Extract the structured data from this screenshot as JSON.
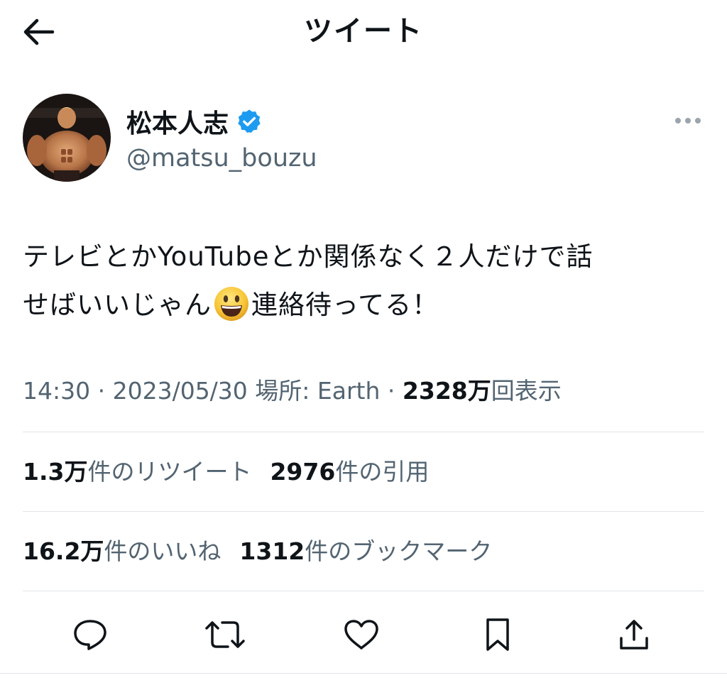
{
  "header": {
    "title": "ツイート",
    "back_icon": "arrow-left-icon"
  },
  "author": {
    "name": "松本人志",
    "handle": "@matsu_bouzu",
    "verified": true,
    "verified_color": "#1d9bf0"
  },
  "tweet": {
    "line1": "テレビとかYouTubeとか関係なく２人だけで話",
    "line2_before_emoji": "せばいいじゃん",
    "emoji": "smiley-emoji",
    "line2_after_emoji": "連絡待ってる！"
  },
  "meta": {
    "time": "14:30",
    "separator1": " · ",
    "date": "2023/05/30",
    "location_label": " 場所: ",
    "location": "Earth",
    "separator2": " · ",
    "views_count": "2328万",
    "views_label": "回表示"
  },
  "stats": {
    "retweets_count": "1.3万",
    "retweets_label": "件のリツイート",
    "quotes_count": "2976",
    "quotes_label": "件の引用",
    "likes_count": "16.2万",
    "likes_label": "件のいいね",
    "bookmarks_count": "1312",
    "bookmarks_label": "件のブックマーク"
  },
  "actions": [
    "reply-icon",
    "retweet-icon",
    "like-icon",
    "bookmark-icon",
    "share-icon"
  ],
  "colors": {
    "text_primary": "#0f1419",
    "text_secondary": "#536471",
    "divider": "#e1e4e8",
    "accent": "#1d9bf0"
  }
}
